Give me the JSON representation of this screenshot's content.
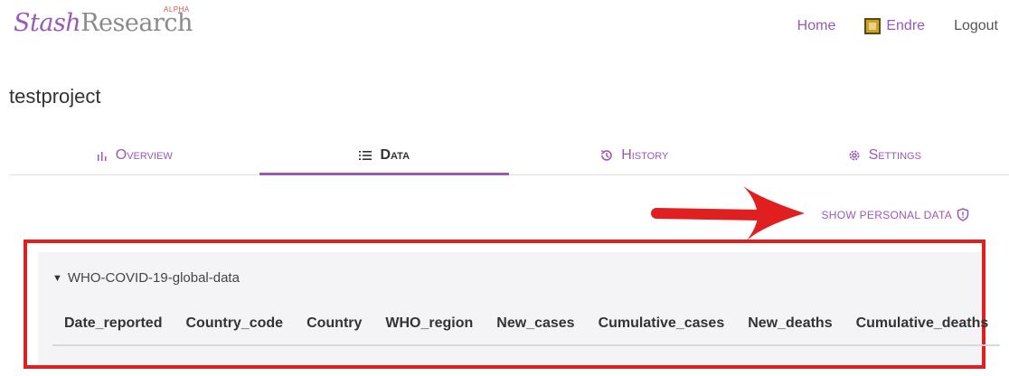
{
  "header": {
    "logo": {
      "part1": "Stash",
      "part2": "Research",
      "badge": "ALPHA"
    },
    "nav": {
      "home": "Home",
      "user": "Endre",
      "logout": "Logout"
    }
  },
  "project": {
    "title": "testproject"
  },
  "tabs": [
    {
      "label": "Overview",
      "icon": "bar-chart-icon",
      "active": false
    },
    {
      "label": "Data",
      "icon": "list-icon",
      "active": true
    },
    {
      "label": "History",
      "icon": "history-icon",
      "active": false
    },
    {
      "label": "Settings",
      "icon": "gear-icon",
      "active": false
    }
  ],
  "actions": {
    "show_personal_data": "SHOW PERSONAL DATA"
  },
  "dataset": {
    "name": "WHO-COVID-19-global-data",
    "columns": [
      "Date_reported",
      "Country_code",
      "Country",
      "WHO_region",
      "New_cases",
      "Cumulative_cases",
      "New_deaths",
      "Cumulative_deaths"
    ]
  },
  "colors": {
    "accent": "#9b59b6",
    "annotation": "#e02020"
  }
}
